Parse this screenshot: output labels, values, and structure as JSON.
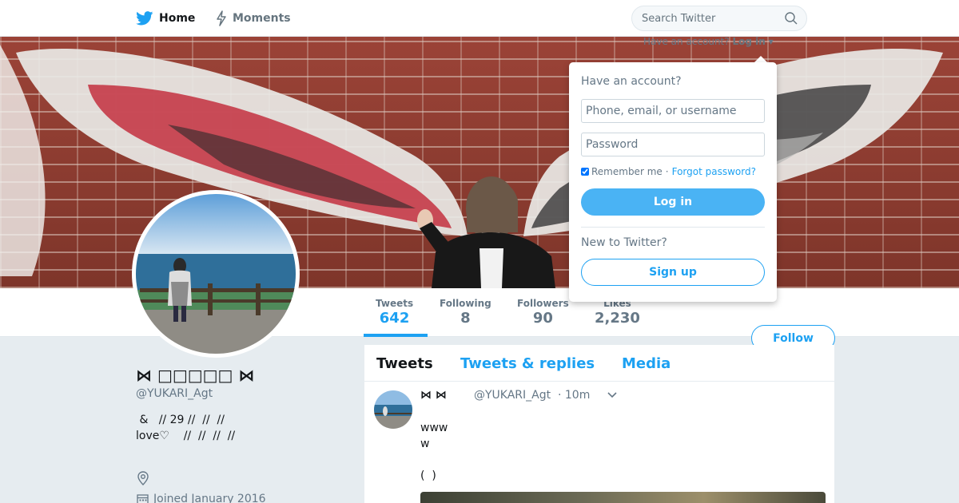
{
  "nav": {
    "home_label": "Home",
    "moments_label": "Moments",
    "search_placeholder": "Search Twitter"
  },
  "login_prompt": {
    "question": "Have an account?",
    "login_link": "Log in",
    "arrow": "▾"
  },
  "login_dropdown": {
    "title": "Have an account?",
    "username_placeholder": "Phone, email, or username",
    "password_placeholder": "Password",
    "remember_label": "Remember me",
    "separator": "·",
    "forgot_label": "Forgot password?",
    "login_button": "Log in",
    "new_label": "New to Twitter?",
    "signup_button": "Sign up"
  },
  "profile": {
    "display_name": "⋈ □□□□□ ⋈",
    "handle": "@YUKARI_Agt",
    "bio": " &   // 29 //  //  //\nlove♡    //  //  //  //",
    "joined": "Joined January 2016"
  },
  "stats": [
    {
      "label": "Tweets",
      "value": "642"
    },
    {
      "label": "Following",
      "value": "8"
    },
    {
      "label": "Followers",
      "value": "90"
    },
    {
      "label": "Likes",
      "value": "2,230"
    }
  ],
  "follow_button": "Follow",
  "timeline": {
    "tabs": [
      "Tweets",
      "Tweets & replies",
      "Media"
    ],
    "tweet": {
      "name": "⋈   ⋈",
      "handle": "@YUKARI_Agt",
      "time": "· 10m",
      "text": "www\nw\n\n(  )"
    }
  },
  "colors": {
    "accent": "#1da1f2",
    "background": "#e6ecf0"
  }
}
